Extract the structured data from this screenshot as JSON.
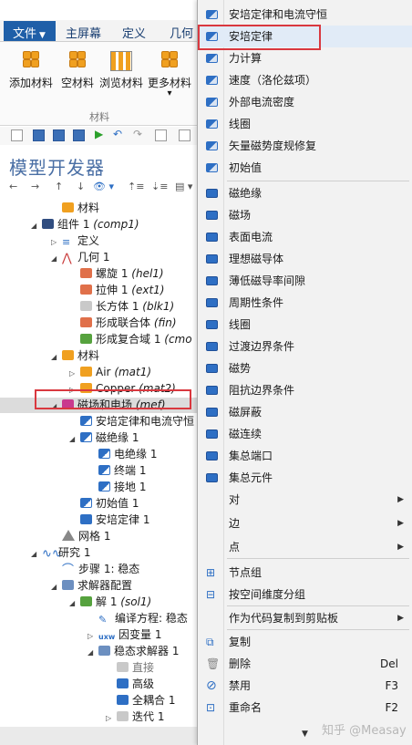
{
  "ribbon": {
    "file_tab": "文件",
    "file_caret": "▼",
    "tabs": [
      "主屏幕",
      "定义",
      "几何"
    ],
    "buttons": [
      "添加材料",
      "空材料",
      "浏览材料",
      "更多材料"
    ],
    "more_caret": "▾",
    "group_label": "材料"
  },
  "model_builder": {
    "title": "模型开发器",
    "nav": [
      "←",
      "→",
      "↑",
      "↓",
      "👁 ▾",
      "⇡≡",
      "⇣≡",
      "▤ ▾"
    ]
  },
  "tree": [
    {
      "label": "材料",
      "tag": ""
    },
    {
      "label": "组件 1",
      "tag": "(comp1)"
    },
    {
      "label": "定义",
      "tag": ""
    },
    {
      "label": "几何 1",
      "tag": ""
    },
    {
      "label": "螺旋 1",
      "tag": "(hel1)"
    },
    {
      "label": "拉伸 1",
      "tag": "(ext1)"
    },
    {
      "label": "长方体 1",
      "tag": "(blk1)"
    },
    {
      "label": "形成联合体",
      "tag": "(fin)"
    },
    {
      "label": "形成复合域 1",
      "tag": "(cmo"
    },
    {
      "label": "材料",
      "tag": ""
    },
    {
      "label": "Air",
      "tag": "(mat1)"
    },
    {
      "label": "Copper",
      "tag": "(mat2)"
    },
    {
      "label": "磁场和电场",
      "tag": "(mef)"
    },
    {
      "label": "安培定律和电流守恒",
      "tag": ""
    },
    {
      "label": "磁绝缘 1",
      "tag": ""
    },
    {
      "label": "电绝缘 1",
      "tag": ""
    },
    {
      "label": "终端 1",
      "tag": ""
    },
    {
      "label": "接地 1",
      "tag": ""
    },
    {
      "label": "初始值 1",
      "tag": ""
    },
    {
      "label": "安培定律 1",
      "tag": ""
    },
    {
      "label": "网格 1",
      "tag": ""
    },
    {
      "label": "研究 1",
      "tag": ""
    },
    {
      "label": "步骤 1: 稳态",
      "tag": ""
    },
    {
      "label": "求解器配置",
      "tag": ""
    },
    {
      "label": "解 1",
      "tag": "(sol1)"
    },
    {
      "label": "编译方程: 稳态",
      "tag": ""
    },
    {
      "label": "因变量 1",
      "tag": ""
    },
    {
      "label": "稳态求解器 1",
      "tag": ""
    },
    {
      "label": "直接",
      "tag": ""
    },
    {
      "label": "高级",
      "tag": ""
    },
    {
      "label": "全耦合 1",
      "tag": ""
    },
    {
      "label": "迭代 1",
      "tag": ""
    }
  ],
  "context_menu": {
    "items": [
      {
        "label": "安培定律和电流守恒"
      },
      {
        "label": "安培定律"
      },
      {
        "label": "力计算"
      },
      {
        "label": "速度（洛伦兹项）"
      },
      {
        "label": "外部电流密度"
      },
      {
        "label": "线圈"
      },
      {
        "label": "矢量磁势度规修复"
      },
      {
        "label": "初始值"
      },
      {
        "label": "磁绝缘"
      },
      {
        "label": "磁场"
      },
      {
        "label": "表面电流"
      },
      {
        "label": "理想磁导体"
      },
      {
        "label": "薄低磁导率间隙"
      },
      {
        "label": "周期性条件"
      },
      {
        "label": "线圈"
      },
      {
        "label": "过渡边界条件"
      },
      {
        "label": "磁势"
      },
      {
        "label": "阻抗边界条件"
      },
      {
        "label": "磁屏蔽"
      },
      {
        "label": "磁连续"
      },
      {
        "label": "集总端口"
      },
      {
        "label": "集总元件"
      },
      {
        "label": "对",
        "arrow": "▶"
      },
      {
        "label": "边",
        "arrow": "▶"
      },
      {
        "label": "点",
        "arrow": "▶"
      },
      {
        "label": "节点组"
      },
      {
        "label": "按空间维度分组"
      },
      {
        "label": "作为代码复制到剪贴板",
        "arrow": "▶"
      },
      {
        "label": "复制"
      },
      {
        "label": "删除",
        "shortcut": "Del"
      },
      {
        "label": "禁用",
        "shortcut": "F3"
      },
      {
        "label": "重命名",
        "shortcut": "F2"
      }
    ],
    "more": "▼"
  },
  "watermark": "知乎 @Measay",
  "colors": {
    "accent": "#1f5fa8",
    "highlight_box": "#d9383f",
    "menu_bg": "#f2f2f2",
    "icon_blue": "#2e6fc4"
  }
}
